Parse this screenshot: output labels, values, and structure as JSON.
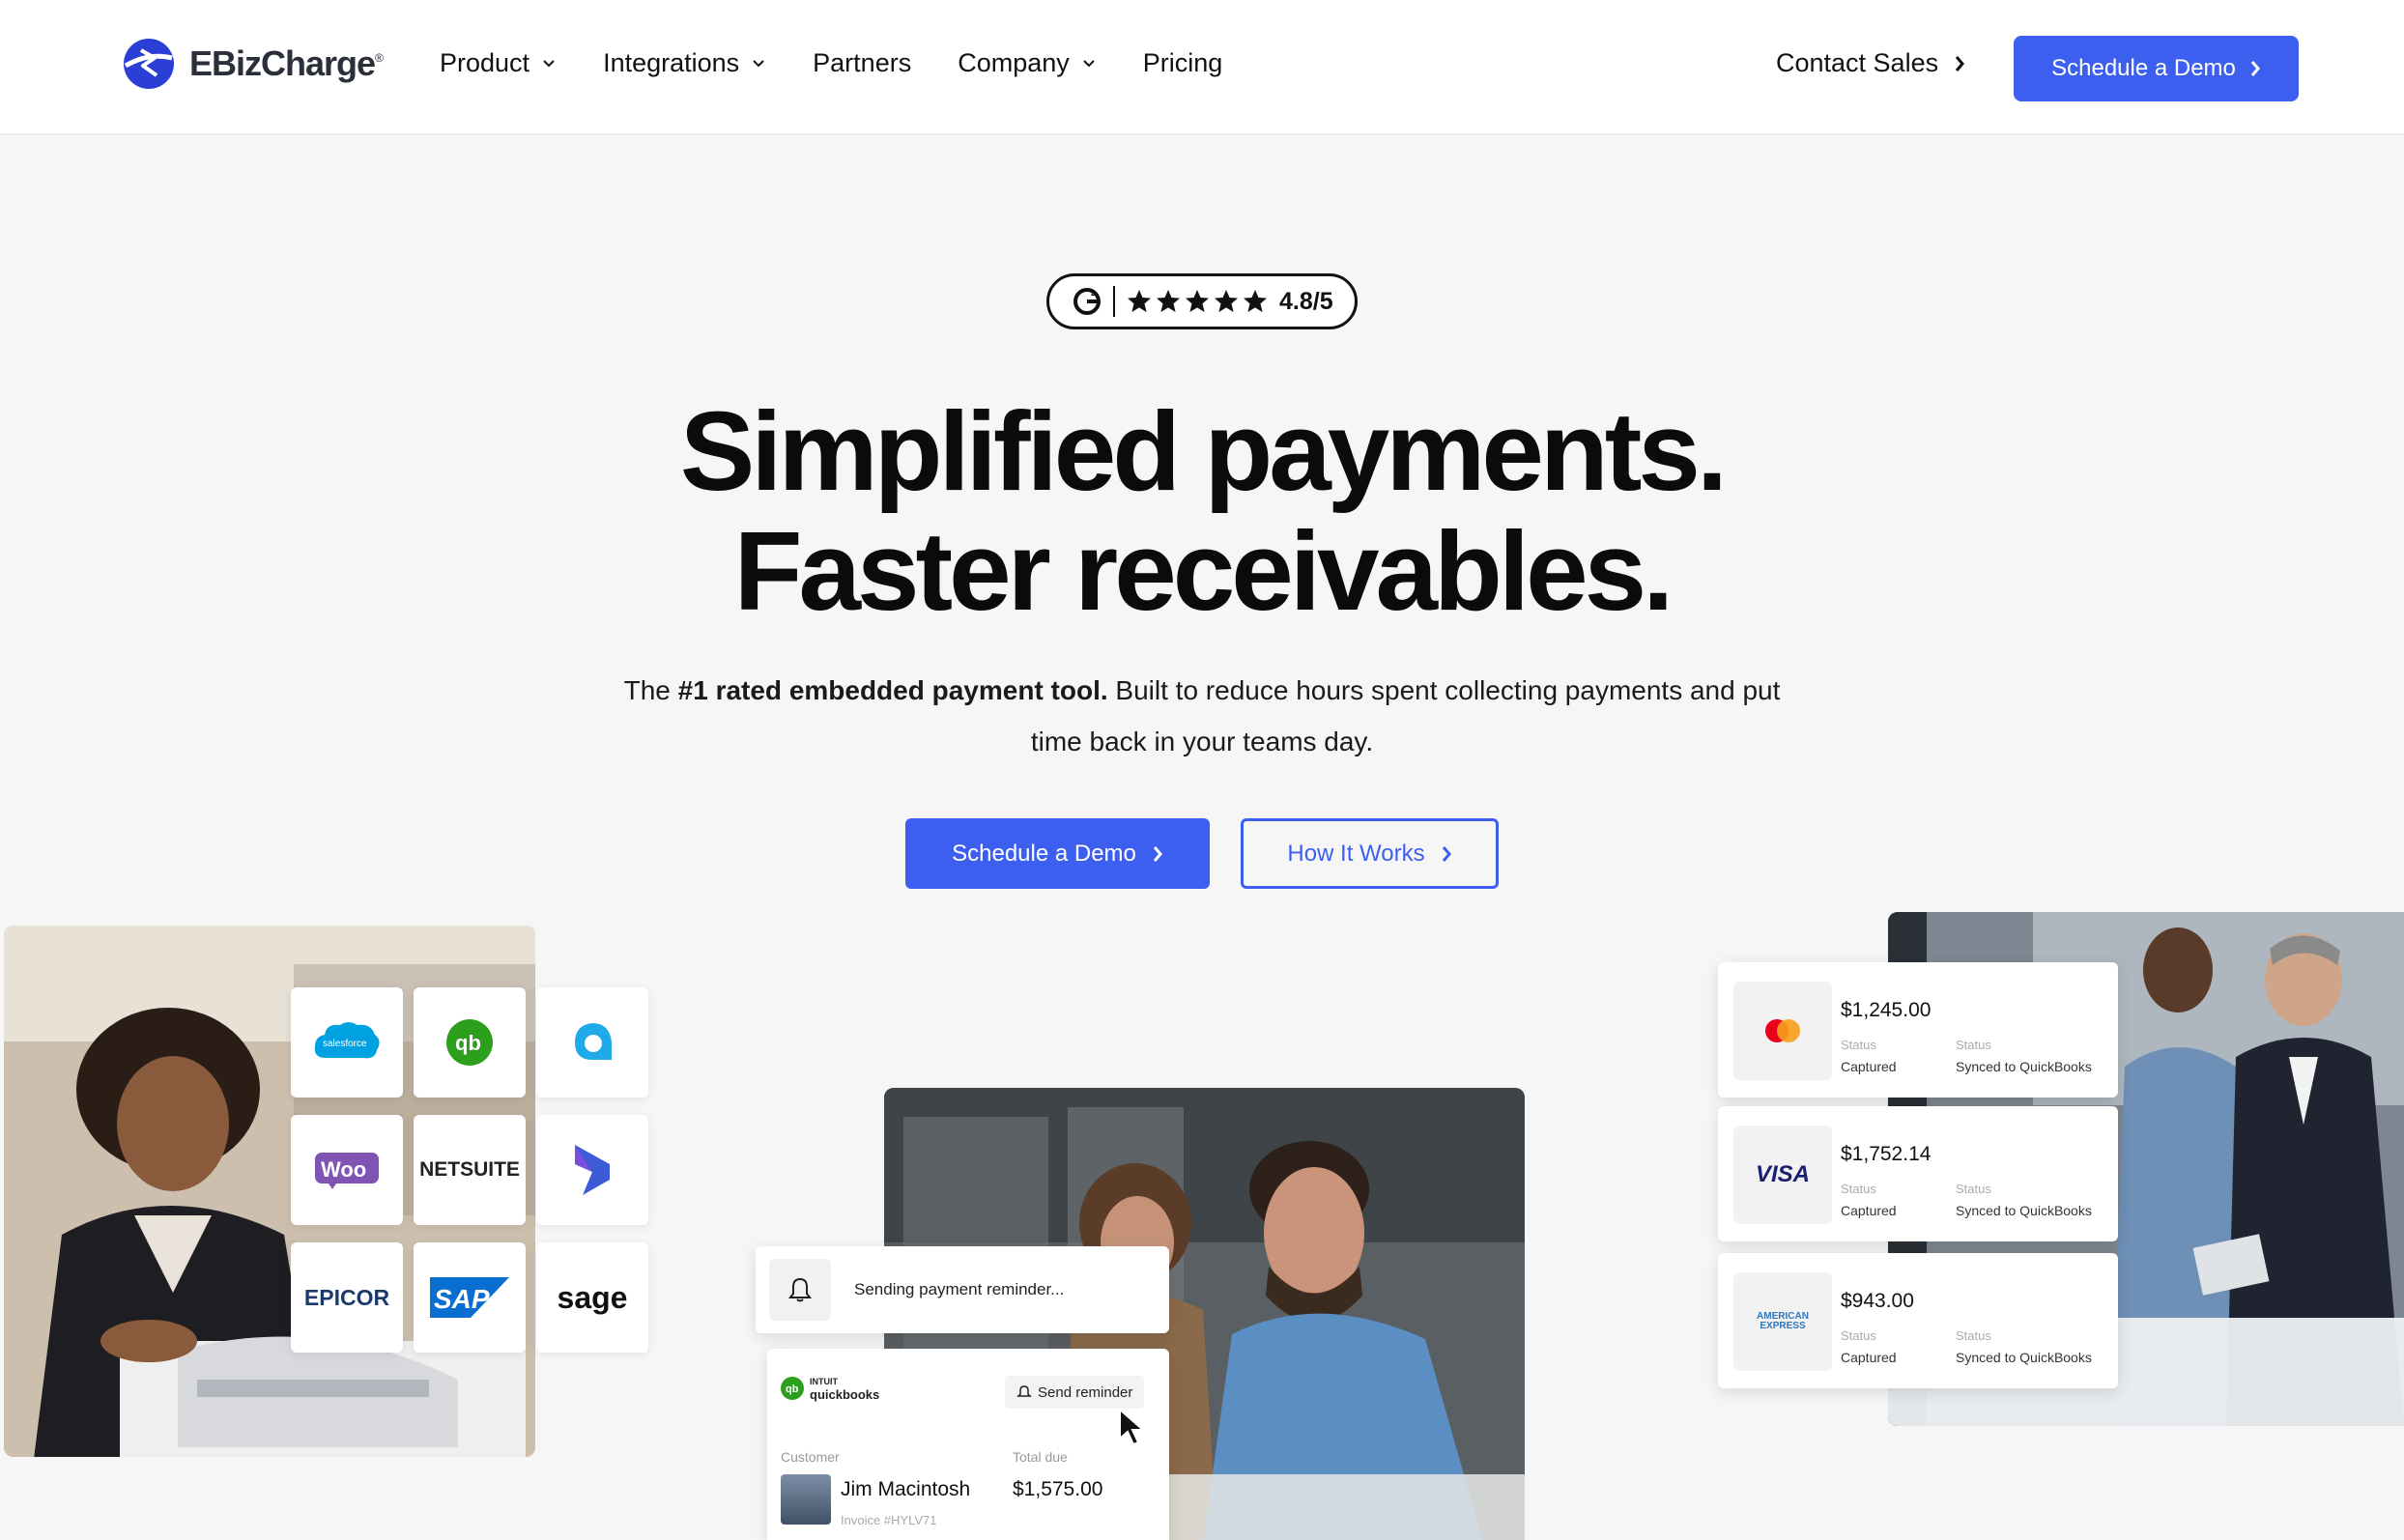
{
  "header": {
    "logo_text": "EBizCharge",
    "logo_mark": "®",
    "nav": [
      {
        "label": "Product",
        "has_dropdown": true
      },
      {
        "label": "Integrations",
        "has_dropdown": true
      },
      {
        "label": "Partners",
        "has_dropdown": false
      },
      {
        "label": "Company",
        "has_dropdown": true
      },
      {
        "label": "Pricing",
        "has_dropdown": false
      }
    ],
    "contact_label": "Contact Sales",
    "demo_label": "Schedule a Demo"
  },
  "hero": {
    "rating": {
      "source_icon": "g2-icon",
      "stars": 5,
      "score": "4.8/5"
    },
    "headline_line1": "Simplified payments.",
    "headline_line2": "Faster receivables.",
    "sub_prefix": "The ",
    "sub_bold": "#1 rated embedded payment tool.",
    "sub_rest": " Built to reduce hours spent collecting payments and put time back in your teams day.",
    "primary_cta": "Schedule a Demo",
    "secondary_cta": "How It Works"
  },
  "integrations": [
    {
      "name": "salesforce",
      "label": "salesforce"
    },
    {
      "name": "quickbooks",
      "label": "qb"
    },
    {
      "name": "acumatica",
      "label": ""
    },
    {
      "name": "woocommerce",
      "label": "Woo"
    },
    {
      "name": "netsuite",
      "label": "NETSUITE"
    },
    {
      "name": "dynamics",
      "label": ""
    },
    {
      "name": "epicor",
      "label": "EPICOR"
    },
    {
      "name": "sap",
      "label": "SAP"
    },
    {
      "name": "sage",
      "label": "sage"
    }
  ],
  "reminder": {
    "text": "Sending payment reminder...",
    "qb_brand_top": "INTUIT",
    "qb_brand": "quickbooks",
    "send_label": "Send reminder",
    "customer_label": "Customer",
    "total_label": "Total due",
    "customer_name": "Jim Macintosh",
    "invoice": "Invoice #HYLV71",
    "total": "$1,575.00"
  },
  "payments": [
    {
      "brand": "mastercard",
      "brand_label": "",
      "amount": "$1,245.00",
      "status_label_1": "Status",
      "status_1": "Captured",
      "status_label_2": "Status",
      "status_2": "Synced to QuickBooks"
    },
    {
      "brand": "visa",
      "brand_label": "VISA",
      "amount": "$1,752.14",
      "status_label_1": "Status",
      "status_1": "Captured",
      "status_label_2": "Status",
      "status_2": "Synced to QuickBooks"
    },
    {
      "brand": "amex",
      "brand_label": "AMERICAN EXPRESS",
      "amount": "$943.00",
      "status_label_1": "Status",
      "status_1": "Captured",
      "status_label_2": "Status",
      "status_2": "Synced to QuickBooks"
    }
  ],
  "colors": {
    "brand_blue": "#3c5ff0",
    "background": "#f6f6f6",
    "text": "#111111"
  }
}
